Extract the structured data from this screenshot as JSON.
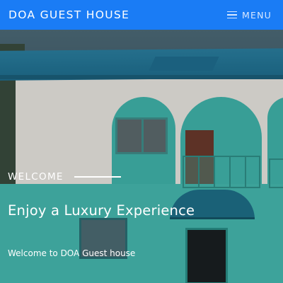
{
  "navbar": {
    "brand": "DOA GUEST HOUSE",
    "menu_icon": "hamburger-menu-icon",
    "menu_label": "MENU",
    "background_color": "#1a7cf5"
  },
  "hero": {
    "eyebrow": "WELCOME",
    "headline": "Enjoy a Luxury Experience",
    "subtext": "Welcome to DOA Guest house"
  }
}
